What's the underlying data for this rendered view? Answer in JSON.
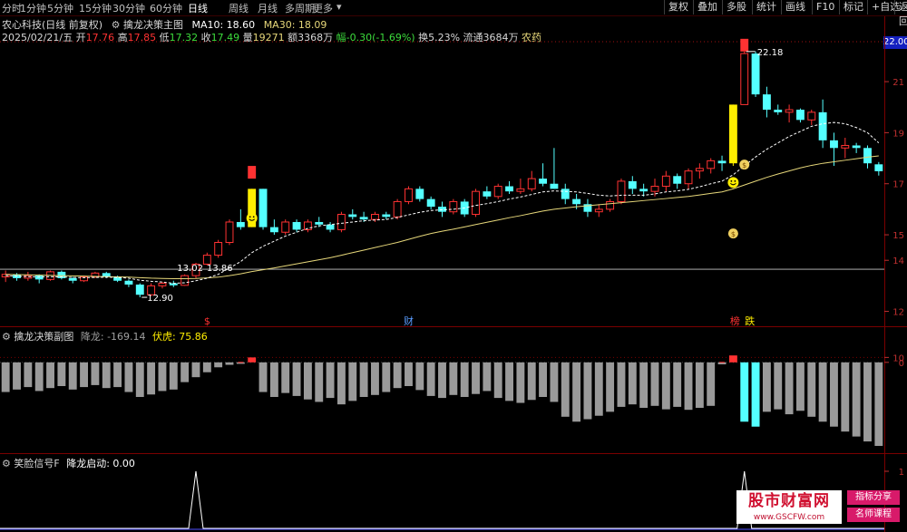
{
  "toolbar": {
    "timeframes": [
      "分时",
      "1分钟",
      "5分钟",
      "15分钟",
      "30分钟",
      "60分钟",
      "日线",
      "周线",
      "月线",
      "多周期",
      "更多"
    ],
    "active_timeframe": "日线",
    "right_buttons": [
      "复权",
      "叠加",
      "多股",
      "统计",
      "画线",
      "F10",
      "标记",
      "+自选",
      "返回"
    ]
  },
  "main_header": {
    "stock_name": "农心科技(日线 前复权)",
    "indicator_name": "擒龙决策主图",
    "ma10_text": "MA10: 18.60",
    "ma30_text": "MA30: 18.09"
  },
  "quote_line": {
    "date": "2025/02/21/五",
    "open_label": "开",
    "open": "17.76",
    "high_label": "高",
    "high": "17.85",
    "low_label": "低",
    "low": "17.32",
    "close_label": "收",
    "close": "17.49",
    "vol_label": "量",
    "vol": "19271",
    "amount": "额3368万",
    "change": "幅-0.30(-1.69%)",
    "turnover": "换5.23%",
    "float": "流通3684万",
    "sector": "农药"
  },
  "price_axis": {
    "current": "22.00",
    "labels": [
      "21",
      "19",
      "17",
      "15",
      "14",
      "12"
    ],
    "values": [
      21,
      19,
      17,
      15,
      14,
      12
    ]
  },
  "annotations": {
    "high_mark": "22.18",
    "low_mark": "12.90",
    "mid_marks": [
      "13.02",
      "13.86"
    ],
    "bottom_tags": [
      "$",
      "财",
      "榜",
      "跌"
    ]
  },
  "sub_header": {
    "name": "擒龙决策副图",
    "jianglong": "降龙: -169.14",
    "fuhu": "伏虎: 75.86",
    "axis_labels": [
      "10",
      "0"
    ]
  },
  "sig_header": {
    "name": "笑脸信号F",
    "value": "降龙启动: 0.00",
    "axis_labels": [
      "1"
    ]
  },
  "watermark": {
    "site": "股市财富网",
    "url": "www.GSCFW.com",
    "tag1": "指标分享",
    "tag2": "名师课程"
  },
  "colors": {
    "up": "#ff3232",
    "down": "#54ffff",
    "ma10": "#ffffff",
    "ma30": "#e6d77a",
    "bg": "#000000",
    "grid_red": "#7a0000",
    "yellow_bar": "#ffee00"
  },
  "chart_data": {
    "type": "candlestick",
    "price_range": [
      11.7,
      22.6
    ],
    "candles": [
      [
        13.35,
        13.6,
        13.15,
        13.45
      ],
      [
        13.45,
        13.5,
        13.2,
        13.3
      ],
      [
        13.3,
        13.55,
        13.2,
        13.4
      ],
      [
        13.4,
        13.45,
        13.1,
        13.25
      ],
      [
        13.25,
        13.6,
        13.2,
        13.55
      ],
      [
        13.55,
        13.6,
        13.25,
        13.3
      ],
      [
        13.3,
        13.35,
        13.1,
        13.2
      ],
      [
        13.2,
        13.4,
        13.15,
        13.35
      ],
      [
        13.35,
        13.55,
        13.3,
        13.5
      ],
      [
        13.5,
        13.55,
        13.3,
        13.35
      ],
      [
        13.35,
        13.4,
        13.15,
        13.2
      ],
      [
        13.2,
        13.25,
        12.95,
        13.05
      ],
      [
        13.05,
        13.1,
        12.55,
        12.65
      ],
      [
        12.65,
        13.1,
        12.6,
        13.0
      ],
      [
        13.0,
        13.15,
        12.9,
        13.1
      ],
      [
        13.1,
        13.2,
        12.95,
        13.02
      ],
      [
        13.02,
        13.45,
        13.0,
        13.4
      ],
      [
        13.4,
        13.9,
        13.3,
        13.85
      ],
      [
        13.85,
        14.3,
        13.8,
        14.2
      ],
      [
        14.2,
        14.8,
        14.1,
        14.7
      ],
      [
        14.7,
        15.6,
        14.6,
        15.5
      ],
      [
        15.5,
        16.0,
        15.2,
        15.3
      ],
      [
        15.3,
        16.8,
        15.3,
        16.8
      ],
      [
        16.8,
        16.8,
        15.2,
        15.3
      ],
      [
        15.3,
        15.6,
        15.0,
        15.1
      ],
      [
        15.1,
        15.6,
        15.0,
        15.5
      ],
      [
        15.5,
        15.6,
        15.1,
        15.2
      ],
      [
        15.2,
        15.6,
        15.1,
        15.5
      ],
      [
        15.5,
        15.7,
        15.3,
        15.4
      ],
      [
        15.4,
        15.5,
        15.1,
        15.2
      ],
      [
        15.2,
        15.9,
        15.1,
        15.8
      ],
      [
        15.8,
        16.0,
        15.6,
        15.7
      ],
      [
        15.7,
        15.9,
        15.5,
        15.6
      ],
      [
        15.6,
        15.9,
        15.5,
        15.8
      ],
      [
        15.8,
        15.9,
        15.6,
        15.7
      ],
      [
        15.7,
        16.4,
        15.6,
        16.3
      ],
      [
        16.3,
        16.9,
        16.2,
        16.8
      ],
      [
        16.8,
        16.9,
        16.3,
        16.4
      ],
      [
        16.4,
        16.5,
        16.0,
        16.1
      ],
      [
        16.1,
        16.3,
        15.7,
        15.9
      ],
      [
        15.9,
        16.4,
        15.8,
        16.3
      ],
      [
        16.3,
        16.4,
        15.7,
        15.8
      ],
      [
        15.8,
        16.8,
        15.7,
        16.7
      ],
      [
        16.7,
        16.9,
        16.4,
        16.5
      ],
      [
        16.5,
        17.0,
        16.4,
        16.9
      ],
      [
        16.9,
        17.1,
        16.6,
        16.7
      ],
      [
        16.7,
        17.2,
        16.6,
        16.8
      ],
      [
        16.8,
        17.5,
        16.7,
        17.2
      ],
      [
        17.2,
        17.8,
        16.9,
        17.0
      ],
      [
        17.0,
        18.4,
        16.8,
        16.8
      ],
      [
        16.8,
        17.0,
        16.2,
        16.4
      ],
      [
        16.4,
        16.6,
        16.0,
        16.2
      ],
      [
        16.2,
        16.4,
        15.7,
        15.9
      ],
      [
        15.9,
        16.2,
        15.7,
        16.0
      ],
      [
        16.0,
        16.4,
        15.9,
        16.3
      ],
      [
        16.3,
        17.2,
        16.2,
        17.1
      ],
      [
        17.1,
        17.3,
        16.6,
        16.8
      ],
      [
        16.8,
        17.0,
        16.5,
        16.7
      ],
      [
        16.7,
        17.2,
        16.5,
        16.9
      ],
      [
        16.9,
        17.5,
        16.7,
        17.3
      ],
      [
        17.3,
        17.4,
        16.8,
        17.0
      ],
      [
        17.0,
        17.6,
        16.8,
        17.5
      ],
      [
        17.5,
        17.8,
        17.2,
        17.6
      ],
      [
        17.6,
        18.0,
        17.4,
        17.9
      ],
      [
        17.9,
        18.1,
        17.5,
        17.8
      ],
      [
        17.8,
        20.1,
        17.7,
        20.1
      ],
      [
        20.1,
        22.18,
        20.1,
        22.1
      ],
      [
        22.1,
        22.18,
        20.4,
        20.5
      ],
      [
        20.5,
        20.8,
        19.6,
        19.9
      ],
      [
        19.9,
        20.1,
        19.7,
        19.8
      ],
      [
        19.8,
        20.1,
        19.4,
        19.9
      ],
      [
        19.9,
        19.95,
        19.4,
        19.5
      ],
      [
        19.5,
        19.9,
        19.3,
        19.8
      ],
      [
        19.8,
        20.3,
        18.4,
        18.7
      ],
      [
        18.7,
        19.0,
        17.7,
        18.4
      ],
      [
        18.4,
        18.8,
        18.0,
        18.5
      ],
      [
        18.5,
        18.6,
        18.2,
        18.4
      ],
      [
        18.4,
        18.5,
        17.6,
        17.8
      ],
      [
        17.76,
        17.85,
        17.32,
        17.49
      ]
    ],
    "ma10": [
      13.4,
      13.38,
      13.36,
      13.35,
      13.36,
      13.35,
      13.33,
      13.32,
      13.33,
      13.34,
      13.33,
      13.3,
      13.22,
      13.18,
      13.15,
      13.1,
      13.12,
      13.2,
      13.3,
      13.45,
      13.7,
      13.95,
      14.3,
      14.55,
      14.75,
      14.95,
      15.1,
      15.25,
      15.35,
      15.4,
      15.45,
      15.5,
      15.55,
      15.58,
      15.6,
      15.68,
      15.78,
      15.88,
      15.95,
      15.98,
      16.0,
      16.05,
      16.15,
      16.22,
      16.3,
      16.4,
      16.48,
      16.58,
      16.68,
      16.72,
      16.7,
      16.68,
      16.62,
      16.55,
      16.52,
      16.55,
      16.55,
      16.55,
      16.6,
      16.68,
      16.72,
      16.78,
      16.88,
      17.0,
      17.1,
      17.35,
      17.7,
      18.05,
      18.35,
      18.6,
      18.85,
      19.05,
      19.25,
      19.35,
      19.4,
      19.35,
      19.2,
      19.0,
      18.6
    ],
    "ma30": [
      13.45,
      13.44,
      13.43,
      13.42,
      13.41,
      13.4,
      13.39,
      13.38,
      13.37,
      13.36,
      13.35,
      13.34,
      13.32,
      13.3,
      13.29,
      13.28,
      13.28,
      13.29,
      13.31,
      13.34,
      13.4,
      13.47,
      13.56,
      13.63,
      13.7,
      13.78,
      13.86,
      13.94,
      14.02,
      14.1,
      14.2,
      14.3,
      14.4,
      14.5,
      14.6,
      14.7,
      14.82,
      14.94,
      15.05,
      15.14,
      15.22,
      15.31,
      15.4,
      15.49,
      15.58,
      15.67,
      15.75,
      15.84,
      15.93,
      16.0,
      16.05,
      16.1,
      16.14,
      16.18,
      16.22,
      16.26,
      16.3,
      16.34,
      16.38,
      16.42,
      16.46,
      16.5,
      16.56,
      16.62,
      16.68,
      16.8,
      16.95,
      17.1,
      17.25,
      17.38,
      17.5,
      17.62,
      17.72,
      17.8,
      17.86,
      17.92,
      17.98,
      18.04,
      18.09
    ],
    "sub_values": [
      -60,
      -55,
      -50,
      -58,
      -52,
      -48,
      -55,
      -50,
      -46,
      -52,
      -50,
      -60,
      -70,
      -65,
      -58,
      -55,
      -40,
      -30,
      -20,
      -10,
      -5,
      -3,
      10,
      -60,
      -70,
      -62,
      -68,
      -75,
      -80,
      -72,
      -85,
      -78,
      -70,
      -66,
      -60,
      -52,
      -48,
      -56,
      -68,
      -72,
      -66,
      -70,
      -64,
      -58,
      -72,
      -78,
      -82,
      -76,
      -70,
      -80,
      -110,
      -120,
      -115,
      -108,
      -100,
      -90,
      -85,
      -92,
      -88,
      -95,
      -90,
      -96,
      -92,
      -88,
      -4,
      14,
      -120,
      -130,
      -100,
      -95,
      -105,
      -98,
      -110,
      -120,
      -130,
      -140,
      -150,
      -160,
      -169
    ],
    "sig_spikes": [
      17,
      66
    ]
  }
}
